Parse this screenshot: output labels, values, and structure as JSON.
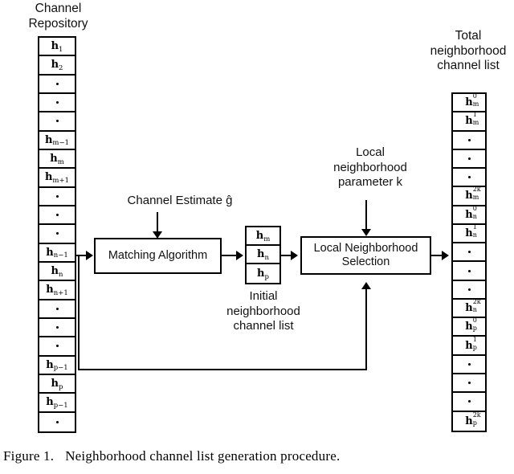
{
  "figure": {
    "caption_number": "Figure 1.",
    "caption_text": "Neighborhood channel list generation procedure."
  },
  "labels": {
    "channel_repository": "Channel\nRepository",
    "total_neighborhood": "Total\nneighborhood\nchannel list",
    "channel_estimate": "Channel Estimate ĝ",
    "local_parameter": "Local\nneighborhood\nparameter k",
    "initial_list": "Initial\nneighborhood\nchannel list"
  },
  "boxes": {
    "matching_algorithm": "Matching Algorithm",
    "local_selection": "Local Neighborhood\nSelection"
  },
  "channel_repository": {
    "cells": [
      {
        "base": "h",
        "sub": "1"
      },
      {
        "base": "h",
        "sub": "2"
      },
      {
        "dot": true
      },
      {
        "dot": true
      },
      {
        "dot": true
      },
      {
        "base": "h",
        "sub": "m−1"
      },
      {
        "base": "h",
        "sub": "m"
      },
      {
        "base": "h",
        "sub": "m+1"
      },
      {
        "dot": true
      },
      {
        "dot": true
      },
      {
        "dot": true
      },
      {
        "base": "h",
        "sub": "n−1"
      },
      {
        "base": "h",
        "sub": "n"
      },
      {
        "base": "h",
        "sub": "n+1"
      },
      {
        "dot": true
      },
      {
        "dot": true
      },
      {
        "dot": true
      },
      {
        "base": "h",
        "sub": "p−1"
      },
      {
        "base": "h",
        "sub": "p"
      },
      {
        "base": "h",
        "sub": "p−1"
      },
      {
        "dot": true
      }
    ]
  },
  "initial_list": {
    "cells": [
      {
        "base": "h",
        "sub": "m"
      },
      {
        "base": "h",
        "sub": "n"
      },
      {
        "base": "h",
        "sub": "p"
      }
    ]
  },
  "total_list": {
    "cells": [
      {
        "base": "h",
        "sub": "m",
        "sup": "0"
      },
      {
        "base": "h",
        "sub": "m",
        "sup": "1"
      },
      {
        "dot": true
      },
      {
        "dot": true
      },
      {
        "dot": true
      },
      {
        "base": "h",
        "sub": "m",
        "sup": "2k"
      },
      {
        "base": "h",
        "sub": "n",
        "sup": "0"
      },
      {
        "base": "h",
        "sub": "n",
        "sup": "1"
      },
      {
        "dot": true
      },
      {
        "dot": true
      },
      {
        "dot": true
      },
      {
        "base": "h",
        "sub": "n",
        "sup": "2k"
      },
      {
        "base": "h",
        "sub": "p",
        "sup": "0"
      },
      {
        "base": "h",
        "sub": "p",
        "sup": "1"
      },
      {
        "dot": true
      },
      {
        "dot": true
      },
      {
        "dot": true
      },
      {
        "base": "h",
        "sub": "p",
        "sup": "2k"
      }
    ]
  },
  "colors": {
    "line": "#000000",
    "background": "#ffffff",
    "text": "#111111"
  }
}
